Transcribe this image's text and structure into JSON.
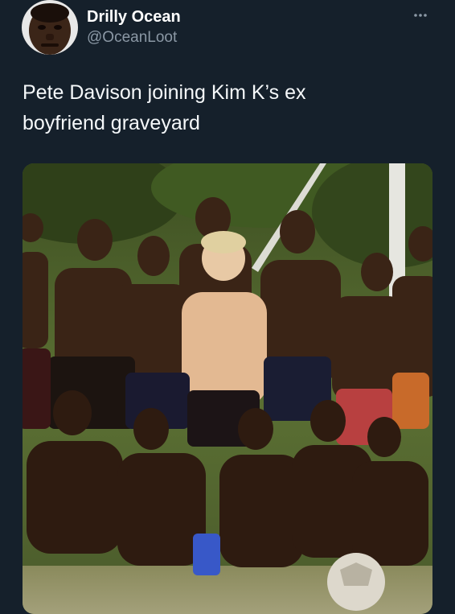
{
  "tweet": {
    "author": {
      "display_name": "Drilly Ocean",
      "handle": "@OceanLoot",
      "avatar": "profile-photo"
    },
    "menu_icon": "more-options-icon",
    "text_lines": [
      "Pete Davison joining Kim K’s ex",
      "boyfriend graveyard"
    ],
    "media": {
      "kind": "photo",
      "description_icon": "group-photo"
    }
  },
  "colors": {
    "background": "#15202b",
    "text_primary": "#ffffff",
    "text_secondary": "#8b98a5"
  }
}
